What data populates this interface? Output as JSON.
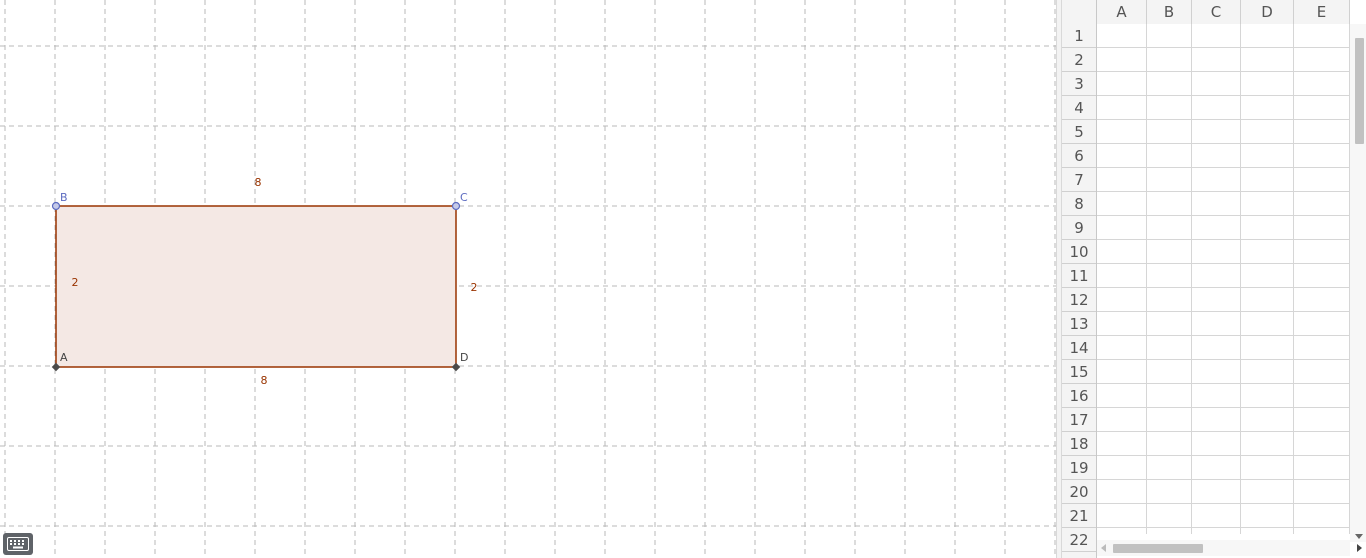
{
  "colors": {
    "grid_line": "#b9b9b9",
    "polygon_fill": "#f4e8e4",
    "polygon_stroke": "#993300",
    "free_point": "#5c6bc0",
    "dependent_point": "#4a4a4a",
    "segment_label": "#993300"
  },
  "geometry": {
    "points": [
      {
        "name": "A",
        "type": "dependent"
      },
      {
        "name": "B",
        "type": "free"
      },
      {
        "name": "C",
        "type": "free"
      },
      {
        "name": "D",
        "type": "dependent"
      }
    ],
    "segments": [
      {
        "from": "A",
        "to": "B",
        "label": "2"
      },
      {
        "from": "B",
        "to": "C",
        "label": "8"
      },
      {
        "from": "C",
        "to": "D",
        "label": "2"
      },
      {
        "from": "D",
        "to": "A",
        "label": "8"
      }
    ]
  },
  "keyboard": {
    "icon": "keyboard-icon"
  },
  "spreadsheet": {
    "columns": [
      "A",
      "B",
      "C",
      "D",
      "E"
    ],
    "rows": [
      "1",
      "2",
      "3",
      "4",
      "5",
      "6",
      "7",
      "8",
      "9",
      "10",
      "11",
      "12",
      "13",
      "14",
      "15",
      "16",
      "17",
      "18",
      "19",
      "20",
      "21",
      "22"
    ]
  }
}
